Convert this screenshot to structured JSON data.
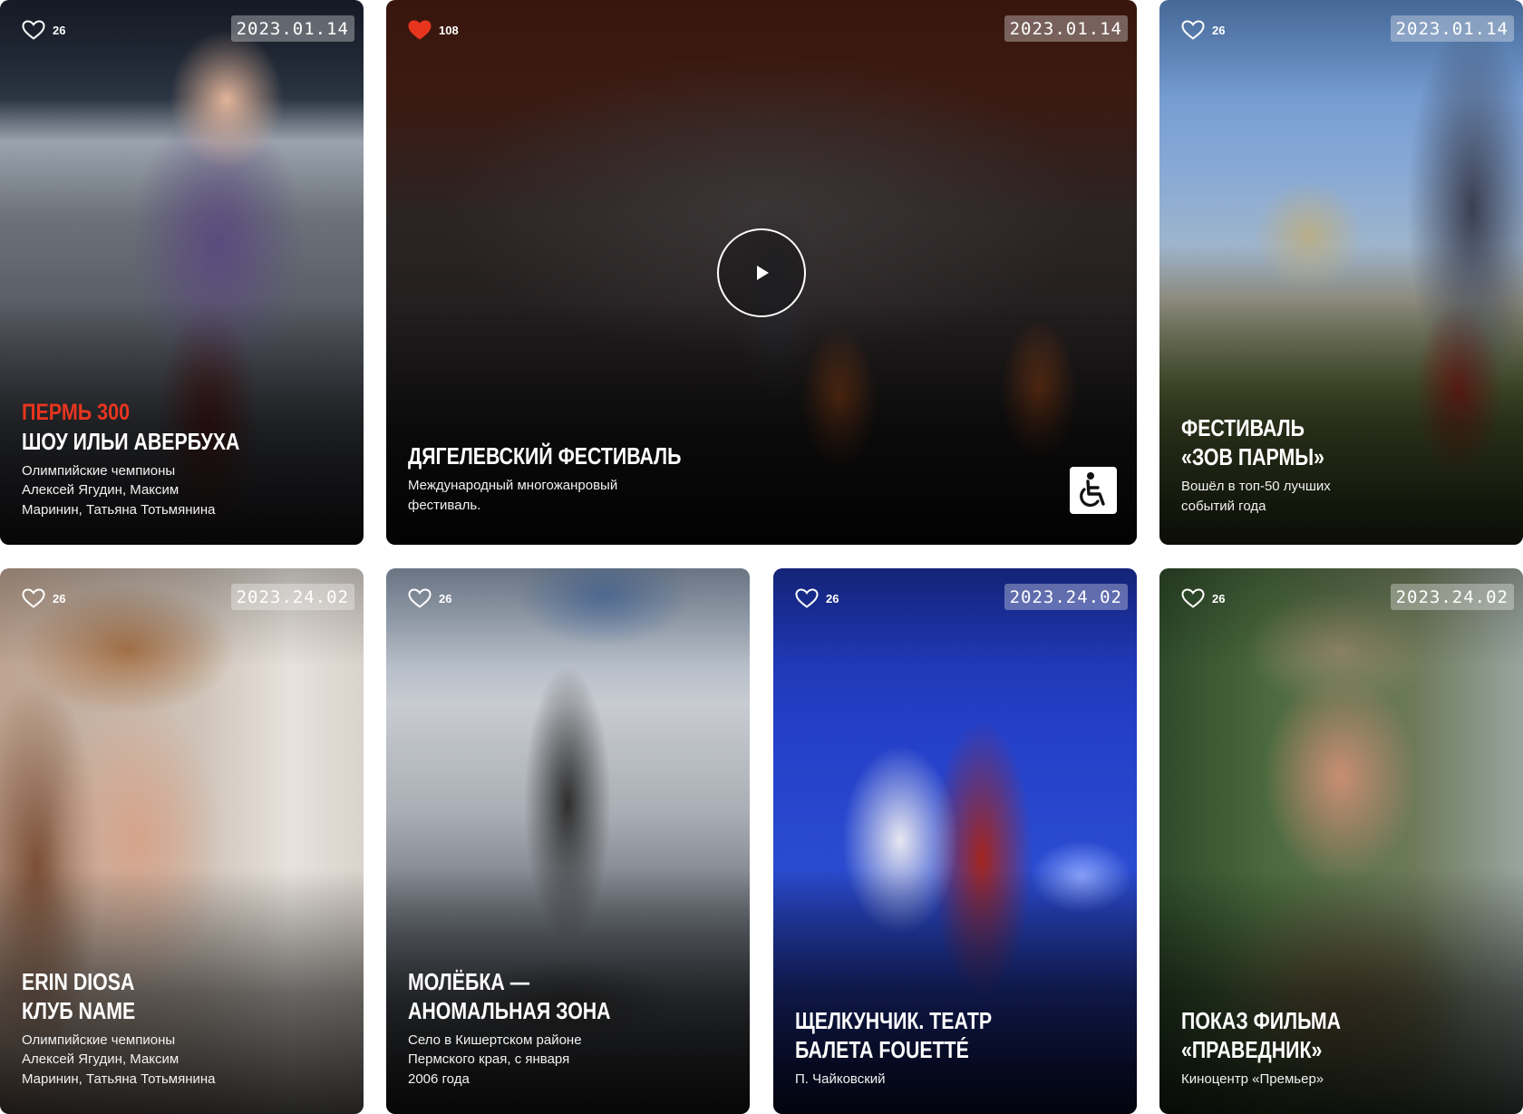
{
  "colors": {
    "accent": "#e8351e",
    "liked": "#e8351e",
    "overlay_text": "#ffffff"
  },
  "cards": [
    {
      "kicker": "ПЕРМЬ 300",
      "title": "ШОУ ИЛЬИ АВЕРБУХА",
      "desc": "Олимпийские чемпионы\nАлексей Ягудин, Максим\nМаринин, Татьяна Тотьмянина",
      "likes": "26",
      "liked": false,
      "date": "2023.01.14",
      "image": "ice-show-host-photo"
    },
    {
      "title": "ДЯГЕЛЕВСКИЙ ФЕСТИВАЛЬ",
      "desc": "Международный многожанровый\nфестиваль.",
      "likes": "108",
      "liked": true,
      "date": "2023.01.14",
      "has_video": true,
      "accessible": true,
      "image": "orchestra-photo"
    },
    {
      "title": "ФЕСТИВАЛЬ\n«ЗОВ ПАРМЫ»",
      "desc": "Вошёл в топ-50 лучших\nсобытий года",
      "likes": "26",
      "liked": false,
      "date": "2023.01.14",
      "image": "knights-battle-photo"
    },
    {
      "title": "ERIN DIOSA\nКЛУБ NAME",
      "desc": "Олимпийские чемпионы\nАлексей Ягудин, Максим\nМаринин, Татьяна Тотьмянина",
      "likes": "26",
      "liked": false,
      "date": "2023.24.02",
      "image": "woman-crown-photo"
    },
    {
      "title": "МОЛЁБКА —\nАНОМАЛЬНАЯ ЗОНА",
      "desc": "Село в Кишертском районе\nПермского края, с января\n2006 года",
      "likes": "26",
      "liked": false,
      "date": "",
      "image": "alien-statue-photo"
    },
    {
      "title": "ЩЕЛКУНЧИК. ТЕАТР\nБАЛЕТА FOUETTÉ",
      "desc": "П. Чайковский",
      "likes": "26",
      "liked": false,
      "date": "2023.24.02",
      "image": "ballet-photo"
    },
    {
      "title": "ПОКАЗ ФИЛЬМА\n«ПРАВЕДНИК»",
      "desc": "Киноцентр «Премьер»",
      "likes": "26",
      "liked": false,
      "date": "2023.24.02",
      "image": "film-actor-photo"
    }
  ]
}
